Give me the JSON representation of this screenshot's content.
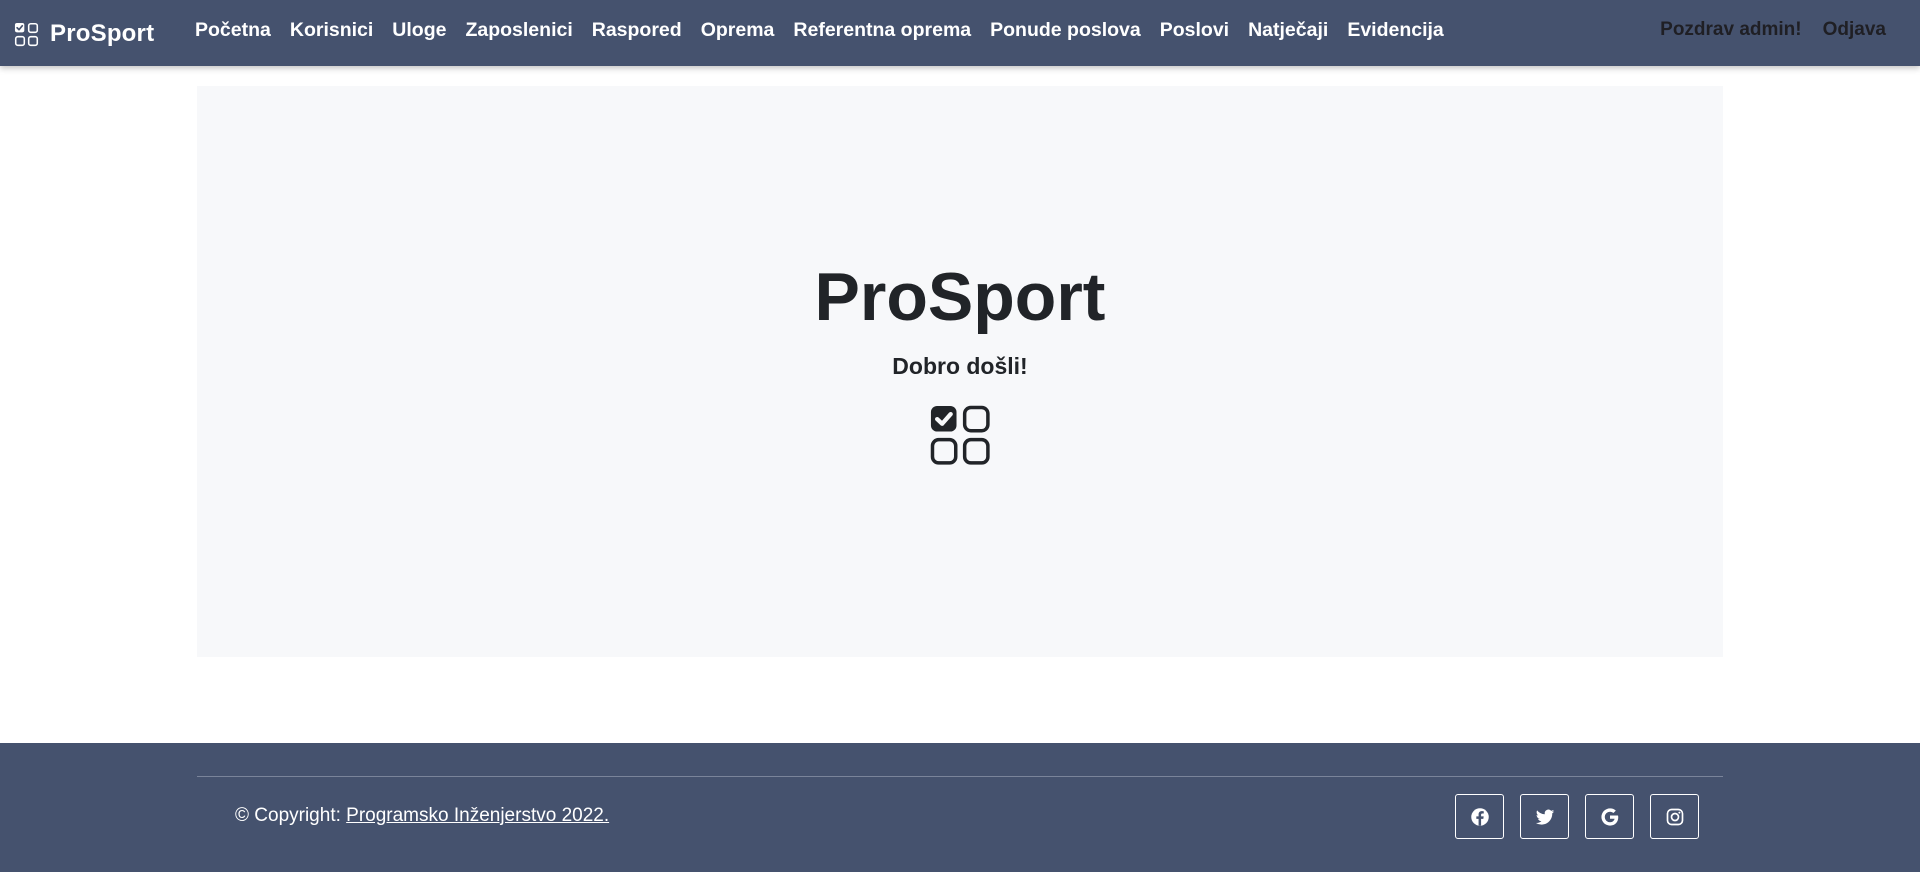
{
  "navbar": {
    "brand": "ProSport",
    "brand_icon": "checklist-grid-icon",
    "links": [
      {
        "label": "Početna",
        "name": "nav-link-pocetna"
      },
      {
        "label": "Korisnici",
        "name": "nav-link-korisnici"
      },
      {
        "label": "Uloge",
        "name": "nav-link-uloge"
      },
      {
        "label": "Zaposlenici",
        "name": "nav-link-zaposlenici"
      },
      {
        "label": "Raspored",
        "name": "nav-link-raspored"
      },
      {
        "label": "Oprema",
        "name": "nav-link-oprema"
      },
      {
        "label": "Referentna oprema",
        "name": "nav-link-referentna-oprema"
      },
      {
        "label": "Ponude poslova",
        "name": "nav-link-ponude-poslova"
      },
      {
        "label": "Poslovi",
        "name": "nav-link-poslovi"
      },
      {
        "label": "Natječaji",
        "name": "nav-link-natjecaji"
      },
      {
        "label": "Evidencija",
        "name": "nav-link-evidencija"
      }
    ],
    "greeting": "Pozdrav admin!",
    "logout": "Odjava"
  },
  "hero": {
    "title": "ProSport",
    "subtitle": "Dobro došli!",
    "icon": "checklist-grid-icon"
  },
  "footer": {
    "copyright_prefix": "© Copyright: ",
    "copyright_link": "Programsko Inženjerstvo 2022.",
    "socials": [
      {
        "name": "facebook-icon"
      },
      {
        "name": "twitter-icon"
      },
      {
        "name": "google-icon"
      },
      {
        "name": "instagram-icon"
      }
    ]
  },
  "colors": {
    "navbar_bg": "#45526e",
    "hero_bg": "#f7f8fa",
    "footer_bg": "#45526e",
    "text_dark": "#212428"
  }
}
